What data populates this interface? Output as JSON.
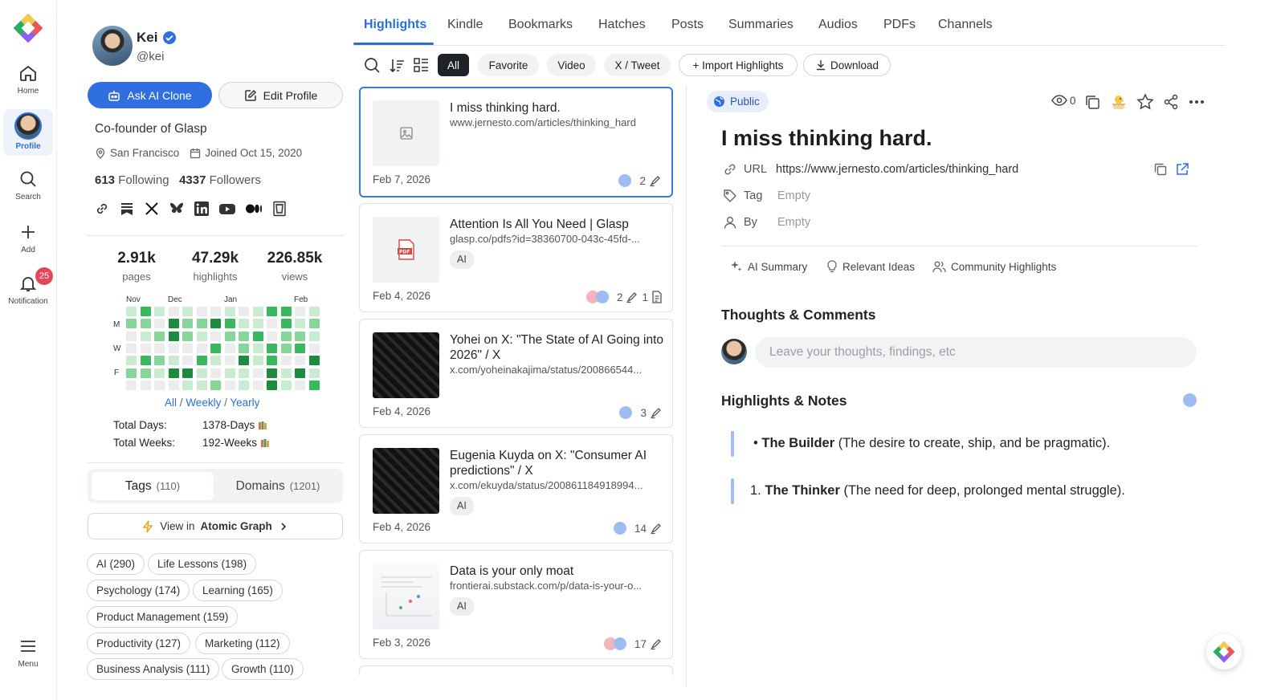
{
  "rail": {
    "home": "Home",
    "profile": "Profile",
    "search": "Search",
    "add": "Add",
    "notification": "Notification",
    "notification_count": "25",
    "menu": "Menu"
  },
  "profile": {
    "name": "Kei",
    "handle": "@kei",
    "ask_ai": "Ask AI Clone",
    "edit": "Edit Profile",
    "bio": "Co-founder of Glasp",
    "location": "San Francisco",
    "joined": "Joined Oct 15, 2020",
    "following_count": "613",
    "following_label": "Following",
    "followers_count": "4337",
    "followers_label": "Followers"
  },
  "stats": {
    "pages": "2.91k",
    "pages_label": "pages",
    "highlights": "47.29k",
    "highlights_label": "highlights",
    "views": "226.85k",
    "views_label": "views"
  },
  "heatmap": {
    "months": [
      "Nov",
      "Dec",
      "Jan",
      "Feb"
    ],
    "days": [
      "M",
      "W",
      "F"
    ],
    "range_all": "All",
    "range_weekly": "Weekly",
    "range_yearly": "Yearly",
    "sep": "/",
    "total_days_label": "Total Days:",
    "total_days": "1378-Days",
    "total_weeks_label": "Total Weeks:",
    "total_weeks": "192-Weeks"
  },
  "tags_tabs": {
    "tags": "Tags",
    "tags_count": "(110)",
    "domains": "Domains",
    "domains_count": "(1201)",
    "graph_prefix": "View in",
    "graph_name": "Atomic Graph"
  },
  "tags": [
    {
      "label": "AI (290)"
    },
    {
      "label": "Life Lessons (198)"
    },
    {
      "label": "Psychology (174)"
    },
    {
      "label": "Learning (165)"
    },
    {
      "label": "Product Management (159)"
    },
    {
      "label": "Productivity (127)"
    },
    {
      "label": "Marketing (112)"
    },
    {
      "label": "Business Analysis (111)"
    },
    {
      "label": "Growth (110)"
    }
  ],
  "tabs": [
    "Highlights",
    "Kindle",
    "Bookmarks",
    "Hatches",
    "Posts",
    "Summaries",
    "Audios",
    "PDFs",
    "Channels"
  ],
  "filters": {
    "all": "All",
    "favorite": "Favorite",
    "video": "Video",
    "tweet": "X / Tweet",
    "import": "+ Import Highlights",
    "download": "Download"
  },
  "cards": [
    {
      "title": "I miss thinking hard.",
      "url": "www.jernesto.com/articles/thinking_hard",
      "date": "Feb 7, 2026",
      "count": "2"
    },
    {
      "title": "Attention Is All You Need | Glasp",
      "url": "glasp.co/pdfs?id=38360700-043c-45fd-...",
      "tag": "AI",
      "date": "Feb 4, 2026",
      "count": "2",
      "notes": "1"
    },
    {
      "title": "Yohei on X: \"The State of AI Going into 2026\" / X",
      "url": "x.com/yoheinakajima/status/200866544...",
      "date": "Feb 4, 2026",
      "count": "3"
    },
    {
      "title": "Eugenia Kuyda on X: \"Consumer AI predictions\" / X",
      "url": "x.com/ekuyda/status/200861184918994...",
      "tag": "AI",
      "date": "Feb 4, 2026",
      "count": "14"
    },
    {
      "title": "Data is your only moat",
      "url": "frontierai.substack.com/p/data-is-your-o...",
      "tag": "AI",
      "date": "Feb 3, 2026",
      "count": "17"
    }
  ],
  "detail": {
    "visibility": "Public",
    "views": "0",
    "title": "I miss thinking hard.",
    "url_label": "URL",
    "url": "https://www.jernesto.com/articles/thinking_hard",
    "tag_label": "Tag",
    "tag_value": "Empty",
    "by_label": "By",
    "by_value": "Empty",
    "tool_summary": "AI Summary",
    "tool_ideas": "Relevant Ideas",
    "tool_community": "Community Highlights",
    "thoughts_title": "Thoughts & Comments",
    "comment_placeholder": "Leave your thoughts, findings, etc",
    "notes_title": "Highlights & Notes",
    "hl1_bold": "The Builder",
    "hl1_rest": "(The desire to create, ship, and be pragmatic).",
    "hl2_num": "1.",
    "hl2_bold": "The Thinker",
    "hl2_rest": "(The need for deep, prolonged mental struggle)."
  },
  "colors": {
    "accent": "#2f6fe0",
    "heat_levels": [
      "#ececec",
      "#c9ecd1",
      "#86d69a",
      "#39b85e",
      "#1c8a3f"
    ],
    "highlight_bar": "#9fbcf2"
  }
}
